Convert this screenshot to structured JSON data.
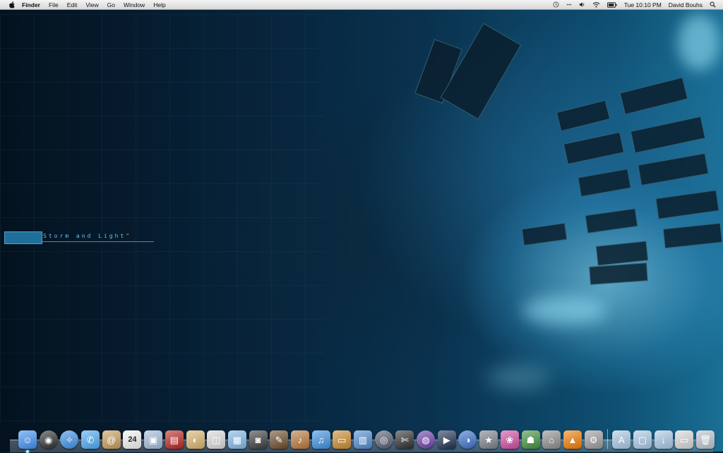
{
  "menubar": {
    "apple_icon": "apple-icon",
    "app_name": "Finder",
    "menus": [
      "File",
      "Edit",
      "View",
      "Go",
      "Window",
      "Help"
    ],
    "status": {
      "time_machine_icon": "time-machine-icon",
      "bluetooth_icon": "bluetooth-icon",
      "volume_icon": "volume-icon",
      "wifi_icon": "wifi-icon",
      "battery_icon": "battery-icon",
      "clock": "Tue 10:10 PM",
      "user": "David Bouhs",
      "spotlight_icon": "spotlight-icon"
    }
  },
  "wallpaper": {
    "title_main": "Storm and Light",
    "title_mark": "\""
  },
  "dock": {
    "apps": [
      {
        "name": "Finder",
        "icon": "finder-icon",
        "color": "#3f8ff0",
        "glyph": "☺",
        "running": true
      },
      {
        "name": "Dashboard",
        "icon": "dashboard-icon",
        "color": "#2d2d2d",
        "glyph": "◉",
        "running": false
      },
      {
        "name": "Safari",
        "icon": "safari-icon",
        "color": "#3c8fe6",
        "glyph": "✧",
        "running": false
      },
      {
        "name": "iChat",
        "icon": "ichat-icon",
        "color": "#4aa8f0",
        "glyph": "✆",
        "running": false
      },
      {
        "name": "Address Book",
        "icon": "address-book-icon",
        "color": "#c79a57",
        "glyph": "@",
        "running": false
      },
      {
        "name": "iCal",
        "icon": "ical-icon",
        "color": "#f2f2f2",
        "glyph": "24",
        "running": false
      },
      {
        "name": "Preview",
        "icon": "preview-icon",
        "color": "#9fb9d8",
        "glyph": "▣",
        "running": false
      },
      {
        "name": "Photo Booth",
        "icon": "photo-booth-icon",
        "color": "#b8241e",
        "glyph": "▤",
        "running": false
      },
      {
        "name": "iPhoto",
        "icon": "iphoto-icon",
        "color": "#d7b36a",
        "glyph": "◐",
        "running": false
      },
      {
        "name": "Image Capture",
        "icon": "image-capture-icon",
        "color": "#d8d8d8",
        "glyph": "◫",
        "running": false
      },
      {
        "name": "Preview Documents",
        "icon": "photos-icon",
        "color": "#7fb6e6",
        "glyph": "▦",
        "running": false
      },
      {
        "name": "Screenshot",
        "icon": "camera-icon",
        "color": "#3a3a3a",
        "glyph": "◙",
        "running": false
      },
      {
        "name": "Art Director",
        "icon": "palette-icon",
        "color": "#6b4a2a",
        "glyph": "✎",
        "running": false
      },
      {
        "name": "GarageBand",
        "icon": "garageband-icon",
        "color": "#b8763a",
        "glyph": "♪",
        "running": false
      },
      {
        "name": "iTunes",
        "icon": "itunes-icon",
        "color": "#3a8fe0",
        "glyph": "♫",
        "running": false
      },
      {
        "name": "Keynote",
        "icon": "keynote-icon",
        "color": "#c9892d",
        "glyph": "▭",
        "running": false
      },
      {
        "name": "Numbers",
        "icon": "numbers-icon",
        "color": "#4d88d0",
        "glyph": "▥",
        "running": false
      },
      {
        "name": "Aperture",
        "icon": "aperture-icon",
        "color": "#555a70",
        "glyph": "◎",
        "running": false
      },
      {
        "name": "Final Cut Pro",
        "icon": "final-cut-icon",
        "color": "#2b2b2b",
        "glyph": "✄",
        "running": false
      },
      {
        "name": "DVD Studio",
        "icon": "dvd-icon",
        "color": "#6b3fa6",
        "glyph": "◍",
        "running": false
      },
      {
        "name": "Motion",
        "icon": "motion-icon",
        "color": "#1c2f4f",
        "glyph": "▶",
        "running": false
      },
      {
        "name": "Color",
        "icon": "color-icon",
        "color": "#3a6ec9",
        "glyph": "◑",
        "running": false
      },
      {
        "name": "iMovie",
        "icon": "imovie-icon",
        "color": "#7a7f88",
        "glyph": "★",
        "running": false
      },
      {
        "name": "Colors",
        "icon": "colors-icon",
        "color": "#d04aa0",
        "glyph": "❀",
        "running": false
      },
      {
        "name": "Automator",
        "icon": "automator-icon",
        "color": "#3f8f3a",
        "glyph": "☗",
        "running": false
      },
      {
        "name": "Utility",
        "icon": "utility-icon",
        "color": "#8c8c8c",
        "glyph": "⌂",
        "running": false
      },
      {
        "name": "VLC",
        "icon": "vlc-icon",
        "color": "#ef7b00",
        "glyph": "▲",
        "running": false
      },
      {
        "name": "System Preferences",
        "icon": "system-preferences-icon",
        "color": "#9a9a9a",
        "glyph": "⚙",
        "running": false
      }
    ],
    "stacks": [
      {
        "name": "Applications",
        "icon": "applications-folder-icon",
        "color": "#a8c6e2",
        "glyph": "A"
      },
      {
        "name": "Documents",
        "icon": "documents-folder-icon",
        "color": "#a8c6e2",
        "glyph": "▢"
      },
      {
        "name": "Downloads",
        "icon": "downloads-folder-icon",
        "color": "#a8c6e2",
        "glyph": "↓"
      },
      {
        "name": "Screen",
        "icon": "display-icon",
        "color": "#d6d6d6",
        "glyph": "▭"
      },
      {
        "name": "Trash",
        "icon": "trash-icon",
        "color": "#b9c2cc",
        "glyph": "🗑"
      }
    ]
  }
}
